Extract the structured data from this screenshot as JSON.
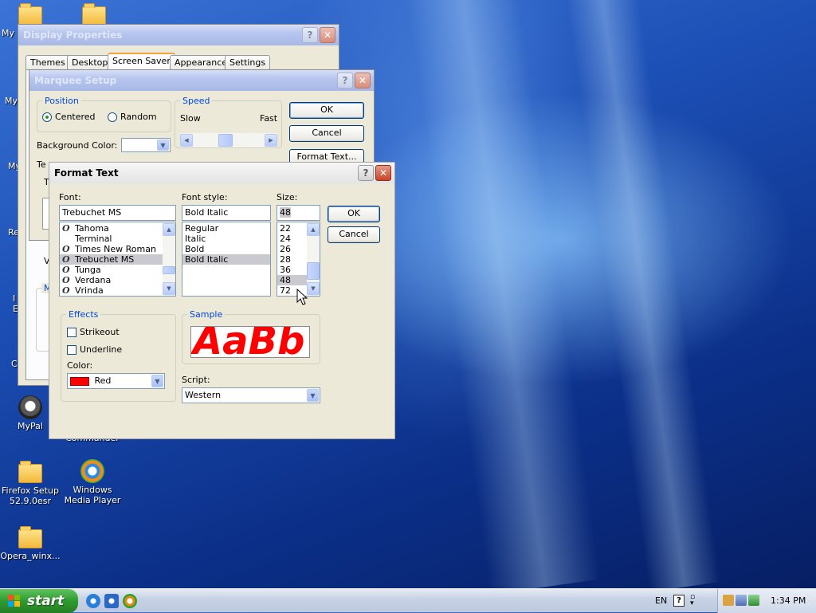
{
  "desktop": {
    "icons": [
      {
        "label": "My"
      },
      {
        "label": "My"
      },
      {
        "label": "My"
      },
      {
        "label": "Re"
      },
      {
        "label": "I"
      },
      {
        "label": "E"
      },
      {
        "label": "C"
      },
      {
        "label": "MyPal"
      },
      {
        "label": "Commander"
      },
      {
        "label": "Firefox Setup 52.9.0esr"
      },
      {
        "label": "Windows Media Player"
      },
      {
        "label": "Opera_winx..."
      }
    ]
  },
  "display_properties": {
    "title": "Display Properties",
    "tabs": [
      "Themes",
      "Desktop",
      "Screen Saver",
      "Appearance",
      "Settings"
    ],
    "selected_tab": "Screen Saver"
  },
  "marquee_setup": {
    "title": "Marquee Setup",
    "position_legend": "Position",
    "centered": "Centered",
    "random": "Random",
    "speed_legend": "Speed",
    "slow": "Slow",
    "fast": "Fast",
    "background_color_label": "Background Color:",
    "ok": "OK",
    "cancel": "Cancel",
    "format_text": "Format Text...",
    "text_label_partial": "Te",
    "peek_t": "T",
    "peek_v": "V",
    "peek_m": "M"
  },
  "format_text": {
    "title": "Format Text",
    "font_label": "Font:",
    "font_value": "Trebuchet MS",
    "fonts": [
      "Tahoma",
      "Terminal",
      "Times New Roman",
      "Trebuchet MS",
      "Tunga",
      "Verdana",
      "Vrinda"
    ],
    "font_icons": [
      true,
      false,
      true,
      true,
      true,
      true,
      true
    ],
    "font_selected_index": 3,
    "style_label": "Font style:",
    "style_value": "Bold Italic",
    "styles": [
      "Regular",
      "Italic",
      "Bold",
      "Bold Italic"
    ],
    "style_selected_index": 3,
    "size_label": "Size:",
    "size_value": "48",
    "sizes": [
      "22",
      "24",
      "26",
      "28",
      "36",
      "48",
      "72"
    ],
    "size_selected_index": 5,
    "ok": "OK",
    "cancel": "Cancel",
    "effects_legend": "Effects",
    "strikeout": "Strikeout",
    "underline": "Underline",
    "color_label": "Color:",
    "color_value": "Red",
    "color_swatch": "#ff0000",
    "sample_legend": "Sample",
    "sample_text": "AaBb",
    "script_label": "Script:",
    "script_value": "Western"
  },
  "taskbar": {
    "start_label": "start",
    "language": "EN",
    "clock": "1:34 PM"
  }
}
